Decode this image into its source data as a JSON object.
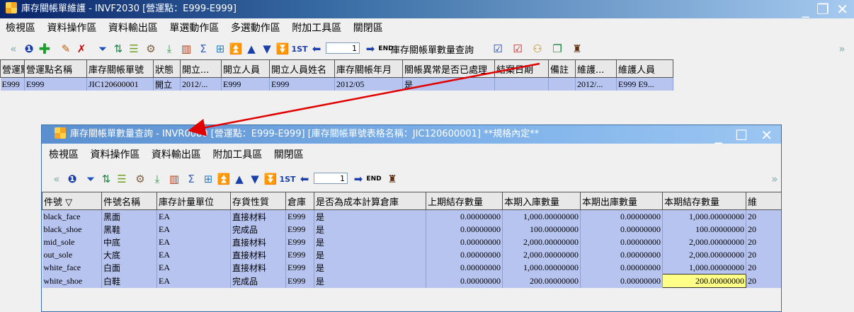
{
  "main_window": {
    "title": "庫存關帳單維護 - INVF2030 [營運點：E999-E999]",
    "menu": [
      "檢視區",
      "資料操作區",
      "資料輸出區",
      "單選動作區",
      "多選動作區",
      "附加工具區",
      "關閉區"
    ],
    "page_input": "1",
    "query_button_label": "庫存關帳單數量查詢",
    "columns": [
      "營運點",
      "營運點名稱",
      "庫存關帳單號",
      "狀態",
      "開立...",
      "開立人員",
      "開立人員姓名",
      "庫存關帳年月",
      "關帳異常是否已處理",
      "結案日期",
      "備註",
      "維護...",
      "維護人員"
    ],
    "row": [
      "E999",
      "E999",
      "JIC120600001",
      "開立",
      "2012/...",
      "E999",
      "E999",
      "2012/05",
      "是",
      "",
      "",
      "2012/...",
      "E999 E9..."
    ]
  },
  "inner_window": {
    "title": "庫存關帳單數量查詢 - INVR0080 [營運點：E999-E999] [庫存關帳單號表格名稱：JIC120600001] **規格內定**",
    "menu": [
      "檢視區",
      "資料操作區",
      "資料輸出區",
      "附加工具區",
      "關閉區"
    ],
    "page_input": "1",
    "columns": [
      "件號 ▽",
      "件號名稱",
      "庫存計量單位",
      "存貨性質",
      "倉庫",
      "是否為成本計算倉庫",
      "上期結存數量",
      "本期入庫數量",
      "本期出庫數量",
      "本期結存數量",
      "維"
    ],
    "rows": [
      [
        "black_face",
        "黑面",
        "EA",
        "直接材料",
        "E999",
        "是",
        "0.00000000",
        "1,000.00000000",
        "0.00000000",
        "1,000.00000000",
        "20"
      ],
      [
        "black_shoe",
        "黑鞋",
        "EA",
        "完成品",
        "E999",
        "是",
        "0.00000000",
        "100.00000000",
        "0.00000000",
        "100.00000000",
        "20"
      ],
      [
        "mid_sole",
        "中底",
        "EA",
        "直接材料",
        "E999",
        "是",
        "0.00000000",
        "2,000.00000000",
        "0.00000000",
        "2,000.00000000",
        "20"
      ],
      [
        "out_sole",
        "大底",
        "EA",
        "直接材料",
        "E999",
        "是",
        "0.00000000",
        "2,000.00000000",
        "0.00000000",
        "2,000.00000000",
        "20"
      ],
      [
        "white_face",
        "白面",
        "EA",
        "直接材料",
        "E999",
        "是",
        "0.00000000",
        "1,000.00000000",
        "0.00000000",
        "1,000.00000000",
        "20"
      ],
      [
        "white_shoe",
        "白鞋",
        "EA",
        "完成品",
        "E999",
        "是",
        "0.00000000",
        "200.00000000",
        "0.00000000",
        "200.00000000",
        "20"
      ]
    ]
  },
  "colors": {
    "row_bg": "#b8c4f0",
    "title_dark": "#0a246a",
    "highlight": "#ffff88",
    "arrow": "#e00000"
  }
}
